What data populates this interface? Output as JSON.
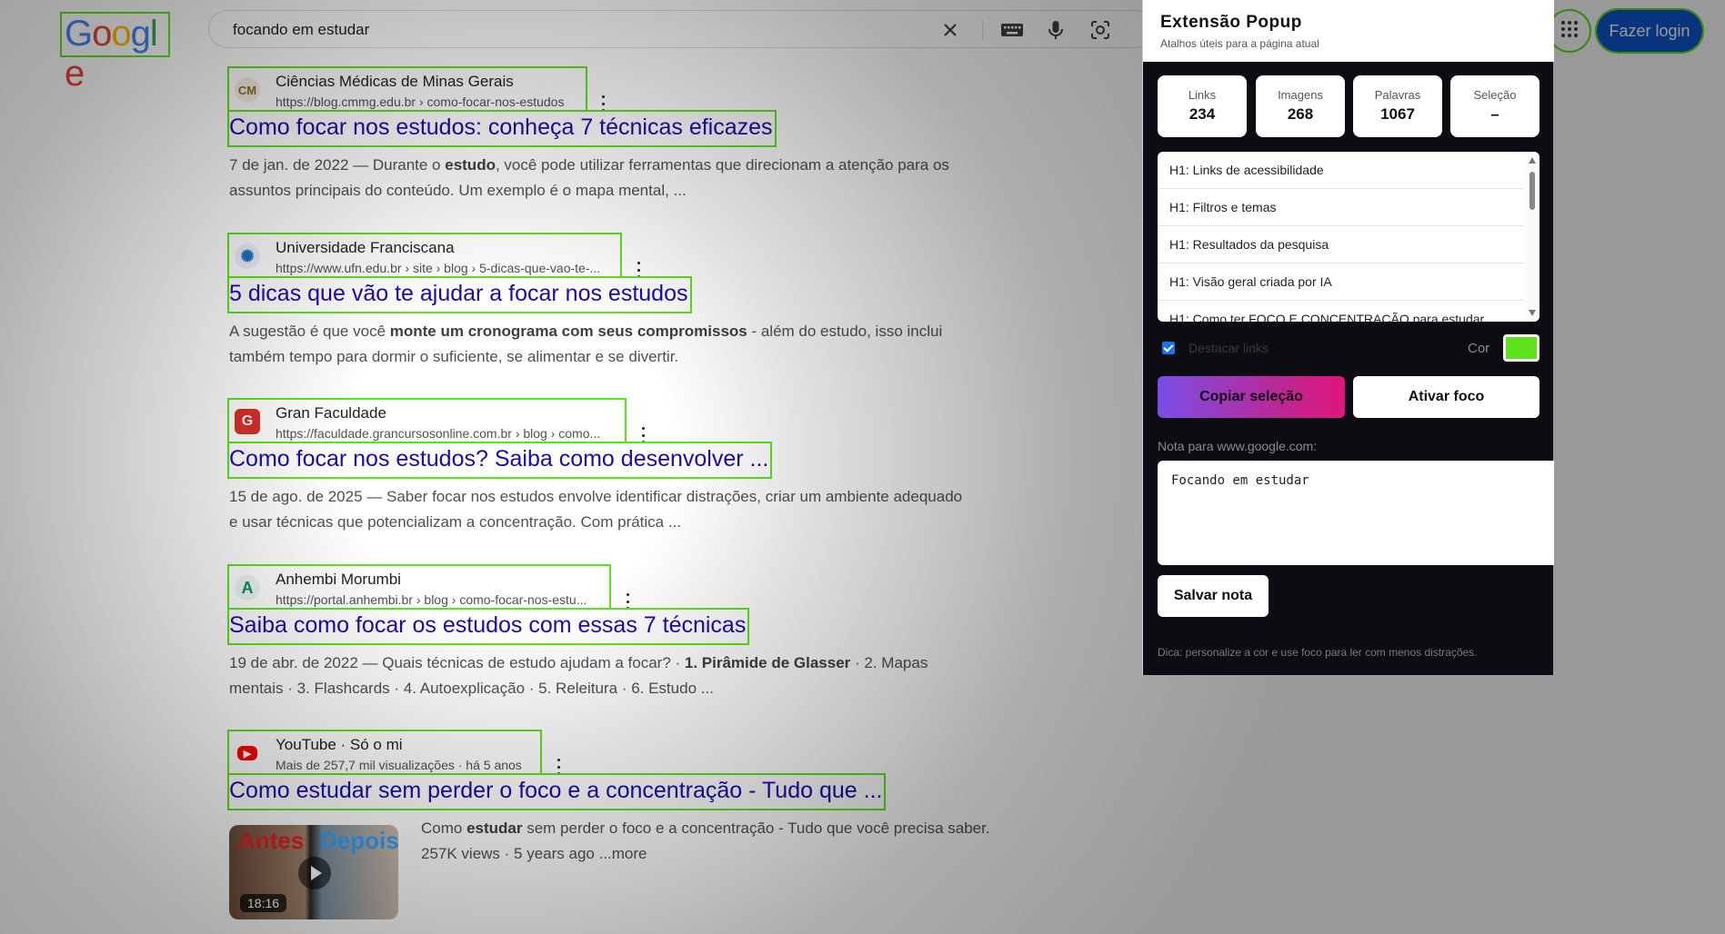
{
  "google": {
    "logo_letters": [
      {
        "char": "G",
        "color": "#4285f4"
      },
      {
        "char": "o",
        "color": "#ea4335"
      },
      {
        "char": "o",
        "color": "#fbbc05"
      },
      {
        "char": "g",
        "color": "#4285f4"
      },
      {
        "char": "l",
        "color": "#34a853"
      },
      {
        "char": "e",
        "color": "#ea4335"
      }
    ],
    "search_query": "focando em estudar",
    "login_label": "Fazer login",
    "icons": [
      "close-icon",
      "keyboard-icon",
      "mic-icon",
      "lens-icon",
      "apps-icon"
    ]
  },
  "results": [
    {
      "site": "Ciências Médicas de Minas Gerais",
      "url": "https://blog.cmmg.edu.br › como-focar-nos-estudos",
      "favicon": "CM",
      "title": "Como focar nos estudos: conheça 7 técnicas eficazes",
      "snippet_date": "7 de jan. de 2022 — ",
      "snippet_a": "Durante o ",
      "snippet_b": "estudo",
      "snippet_c": ", você pode utilizar ferramentas que direcionam a atenção para os assuntos principais do conteúdo. Um exemplo é o mapa mental, ..."
    },
    {
      "site": "Universidade Franciscana",
      "url": "https://www.ufn.edu.br › site › blog › 5-dicas-que-vao-te-...",
      "favicon": "✺",
      "title": "5 dicas que vão te ajudar a focar nos estudos",
      "snippet_a": "A sugestão é que você ",
      "snippet_b": "monte um cronograma com seus compromissos",
      "snippet_c": " - além do estudo, isso inclui também tempo para dormir o suficiente, se alimentar e se divertir."
    },
    {
      "site": "Gran Faculdade",
      "url": "https://faculdade.grancursosonline.com.br › blog › como...",
      "favicon": "G",
      "title": "Como focar nos estudos? Saiba como desenvolver ...",
      "snippet_date": "15 de ago. de 2025 — ",
      "snippet_a": "Saber focar nos estudos envolve identificar distrações, criar um ambiente adequado e usar técnicas que potencializam a concentração. Com prática ..."
    },
    {
      "site": "Anhembi Morumbi",
      "url": "https://portal.anhembi.br › blog › como-focar-nos-estu...",
      "favicon": "A",
      "title": "Saiba como focar os estudos com essas 7 técnicas",
      "snippet_date": "19 de abr. de 2022 — ",
      "snippet_a": "Quais técnicas de estudo ajudam a focar? · ",
      "snippet_b": "1. Pirâmide de Glasser",
      "snippet_c": " · 2. Mapas mentais · 3. Flashcards · 4. Autoexplicação · 5. Releitura · 6. Estudo ..."
    },
    {
      "site": "YouTube · Só o mi",
      "url": "Mais de 257,7 mil visualizações · há 5 anos",
      "favicon": "▶",
      "title": "Como estudar sem perder o foco e a concentração - Tudo que ...",
      "snippet_a": "Como ",
      "snippet_b": "estudar",
      "snippet_c": " sem perder o foco e a concentração - Tudo que você precisa saber. 257K views · 5 years ago ...more",
      "thumb_left": "Antes",
      "thumb_right": "Depois",
      "duration": "18:16"
    }
  ],
  "popup": {
    "title": "Extensão Popup",
    "subtitle": "Atalhos úteis para a página atual",
    "stats": [
      {
        "label": "Links",
        "value": "234"
      },
      {
        "label": "Imagens",
        "value": "268"
      },
      {
        "label": "Palavras",
        "value": "1067"
      },
      {
        "label": "Seleção",
        "value": "–"
      }
    ],
    "headings": [
      "H1: Links de acessibilidade",
      "H1: Filtros e temas",
      "H1: Resultados da pesquisa",
      "H1: Visão geral criada por IA",
      "H1: Como ter FOCO E CONCENTRAÇÃO para estudar"
    ],
    "highlight_label": "Destacar links",
    "highlight_checked": true,
    "color_label": "Cor",
    "color_value": "#5ee31a",
    "copy_button": "Copiar seleção",
    "focus_button": "Ativar foco",
    "note_label": "Nota para www.google.com:",
    "note_text": "Focando em estudar",
    "save_button": "Salvar nota",
    "tip": "Dica: personalize a cor e use foco para ler com menos distrações."
  }
}
